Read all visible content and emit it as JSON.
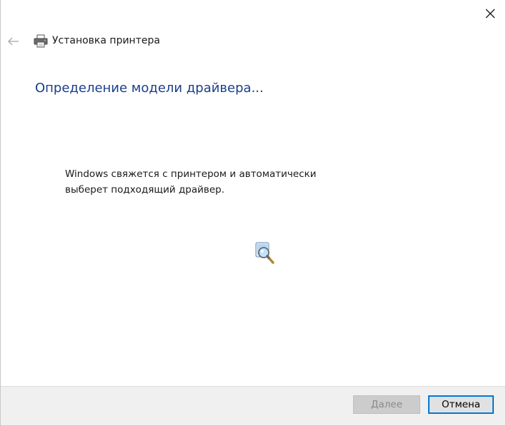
{
  "window": {
    "title": "Установка принтера",
    "close_icon": "close-icon",
    "back_icon": "back-arrow-icon",
    "printer_icon": "printer-icon"
  },
  "main": {
    "heading": "Определение модели драйвера...",
    "message": "Windows свяжется с принтером и автоматически выберет подходящий драйвер.",
    "search_icon": "search-magnifier-icon"
  },
  "footer": {
    "next_label": "Далее",
    "next_enabled": false,
    "cancel_label": "Отмена"
  },
  "colors": {
    "heading": "#1b3f8b",
    "focus_border": "#0078d7",
    "footer_bg": "#f0f0f0",
    "disabled_text": "#8a8a8a"
  }
}
